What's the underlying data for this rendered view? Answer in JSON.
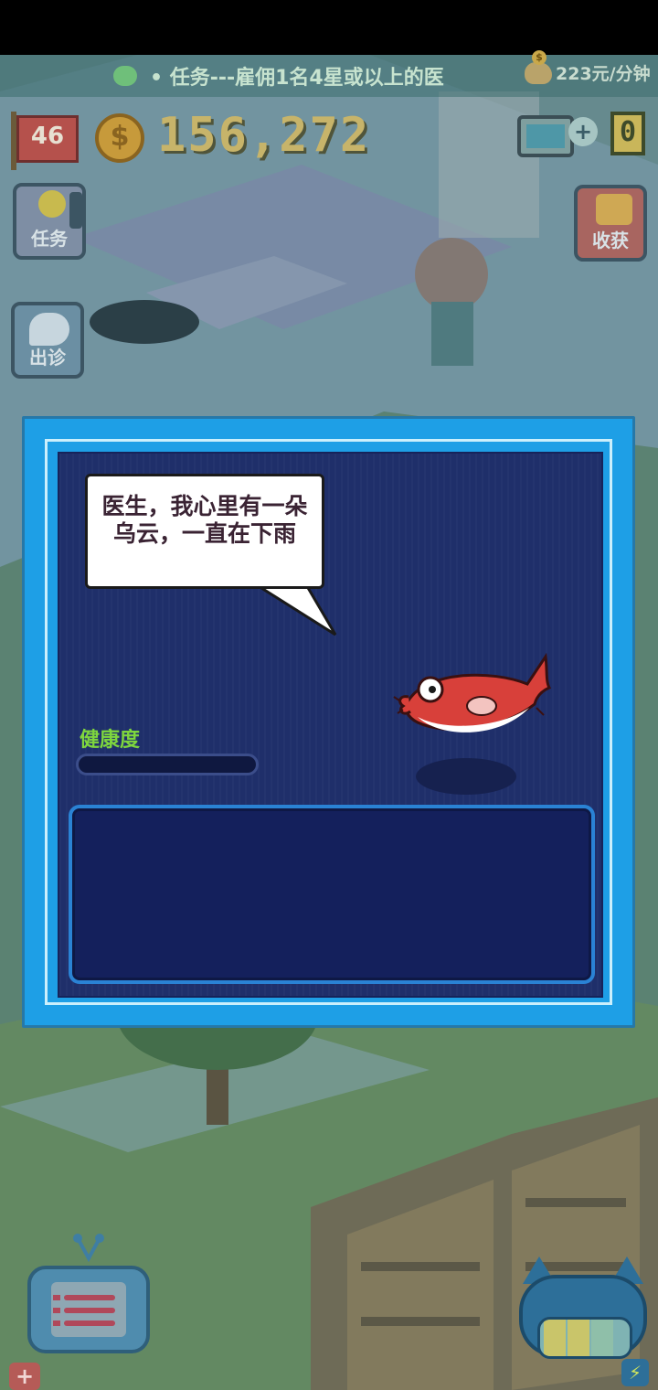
{
  "hud": {
    "mission_ticker": "• 任务---雇佣1名4星或以上的医",
    "income_rate": "223元/分钟",
    "level": "46",
    "coin_symbol": "$",
    "money": "156,272",
    "inbox_plus": "+",
    "inbox_count": "0"
  },
  "side_buttons": {
    "task_label": "任务",
    "outcall_label": "出诊",
    "harvest_label": "收获"
  },
  "dialog": {
    "speech_text": "医生，我心里有一朵乌云，一直在下雨",
    "health_label": "健康度",
    "health_value": 0
  },
  "bottom": {
    "plus": "+",
    "bolt": "⚡"
  },
  "colors": {
    "dialog_frame": "#1e9fe6",
    "dialog_inner": "#1f2f6a",
    "health_text": "#7ed63e",
    "fish": "#d8403a"
  },
  "icons": [
    "chat-icon",
    "piggy-bank-icon",
    "level-flag-icon",
    "coin-icon",
    "tv-icon",
    "lightbulb-icon",
    "ambulance-icon",
    "harvest-runner-icon",
    "red-fish-patient",
    "menu-robot-icon",
    "cat-battery-icon",
    "bolt-icon",
    "medical-cross-icon"
  ]
}
